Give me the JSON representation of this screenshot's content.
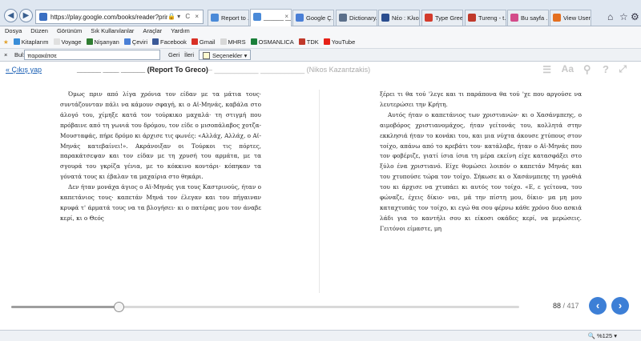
{
  "browser": {
    "address": "https://play.google.com/books/reader?printsec=fr",
    "tabs": [
      {
        "label": "Report to ...",
        "color": "#4a8ad8",
        "active": false
      },
      {
        "label": "______ ____ ...",
        "color": "#4a8ad8",
        "active": true
      },
      {
        "label": "Google Ç...",
        "color": "#4a7fd6",
        "active": false
      },
      {
        "label": "Dictionary...",
        "color": "#5b6f8a",
        "active": false
      },
      {
        "label": "Νέο : Κλιο...",
        "color": "#2a4d8f",
        "active": false
      },
      {
        "label": "Type Gree...",
        "color": "#d33b2c",
        "active": false
      },
      {
        "label": "Tureng - t...",
        "color": "#c0392b",
        "active": false
      },
      {
        "label": "Bu sayfa ...",
        "color": "#d34b8a",
        "active": false
      },
      {
        "label": "View User...",
        "color": "#e46f1f",
        "active": false
      }
    ],
    "menu": [
      "Dosya",
      "Düzen",
      "Görünüm",
      "Sık Kullanılanlar",
      "Araçlar",
      "Yardım"
    ],
    "favorites": [
      {
        "label": "Kitaplarım",
        "color": "#3a8ed8"
      },
      {
        "label": "Voyage",
        "color": "#e0e0e0"
      },
      {
        "label": "Nişanyan",
        "color": "#2f7d32"
      },
      {
        "label": "Çeviri",
        "color": "#4a7fd6"
      },
      {
        "label": "Facebook",
        "color": "#3b5998"
      },
      {
        "label": "Gmail",
        "color": "#d93025"
      },
      {
        "label": "MHRS",
        "color": "#d8d8d8"
      },
      {
        "label": "OSMANLICA",
        "color": "#1b7f3a"
      },
      {
        "label": "TDK",
        "color": "#c0392b"
      },
      {
        "label": "YouTube",
        "color": "#e62117"
      }
    ],
    "findbar": {
      "close": "×",
      "label": "Bul:",
      "query": "παρακάτσε",
      "prev": "Geri",
      "next": "İleri",
      "options": "Seçenekler ▾"
    },
    "zoom": "%125"
  },
  "reader": {
    "back_link": "« Çıkış yap",
    "title": "______ ____ ______ (Report To Greco)",
    "author": "– ___________ ___________ (Nikos Kazantzakis)",
    "left_paragraphs": [
      "Όμως πριν από λίγα χρόνια τον είδαν με τα μάτια τους· συντάζουνταν πάλι να κάμουν σφαγή, κι ο Αϊ-Μηνάς, καβάλα στο άλογό του, χίμηξε κατά τον τούρκικο μαχαλά· τη στιγμή που πρόβαινε από τη γωνιά του δρόμου, τον είδε ο μισοπάλαβος χοτζα-Μουσταφάς, πήρε δρόμο κι άρχισε τις φωνές: «Αλλάχ, Αλλάχ, ο Αϊ-Μηνάς κατεβαίνει!». Ακράνοιξαν οι Τούρκοι τις πόρτες, παρακάτσεψαν και τον είδαν με τη χρυσή του αρμάτα, με τα σγουρά του γκρίζα γένια, με το κόκκινο κοντάρι· κόπηκαν τα γόνατά τους κι έβαλαν τα μαχαίρια στο θηκάρι.",
      "Δεν ήταν μονάχα άγιος ο Αϊ-Μηνάς για τους Καστρινούς, ήταν ο καπετάνιος τους· καπετάν Μηνά τον έλεγαν και του πήγαιναν κρυφά τ' άρματά τους να τα βλογήσει· κι ο πατέρας μου τον άναβε κερί, κι ο Θεός"
    ],
    "right_paragraphs": [
      "ξέρει τι θα τού 'λεγε και τι παράπονα θα τού 'χε που αργούσε να λευτερώσει την Κρήτη.",
      "Αυτός ήταν ο καπετάνιος των χριστιανών· κι ο Χασάνμπεης, ο αιμοβόρος χριστιανομάχος, ήταν γείτονάς του, κολλητά στην εκκλησιά ήταν το κονάκι του, και μια νύχτα άκουσε χτύπους στον τοίχο, απάνω από το κρεβάτι του· κατάλαβε, ήταν ο Αϊ-Μηνάς που τον φοβέριζε, γιατί ίσια ίσια τη μέρα εκείνη είχε κατασφάξει στο ξύλο ένα χριστιανό. Είχε θυμώσει λοιπόν ο καπετάν Μηνάς και του χτυπούσε τώρα τον τοίχο. Σήκωσε κι ο Χασάνμπεης τη γροθιά του κι άρχισε να χτυπάει κι αυτός τον τοίχο. «Ε, ε γείτονα, του φώναζε, έχεις δίκιο· ναι, μά την πίστη μου, δίκιο· μα μη μου καταχτυπάς τον τοίχο, κι εγώ θα σου φέρνω κάθε χρόνο δυο ασκιά λάδι για το καντήλι σου κι είκοσι οκάδες κερί, να μερώσεις. Γειτόνοι είμαστε, μη"
    ],
    "page_current": "88",
    "page_separator": " / ",
    "page_total": "417",
    "progress_fraction": 0.211,
    "accent_color": "#3d7fd6"
  }
}
